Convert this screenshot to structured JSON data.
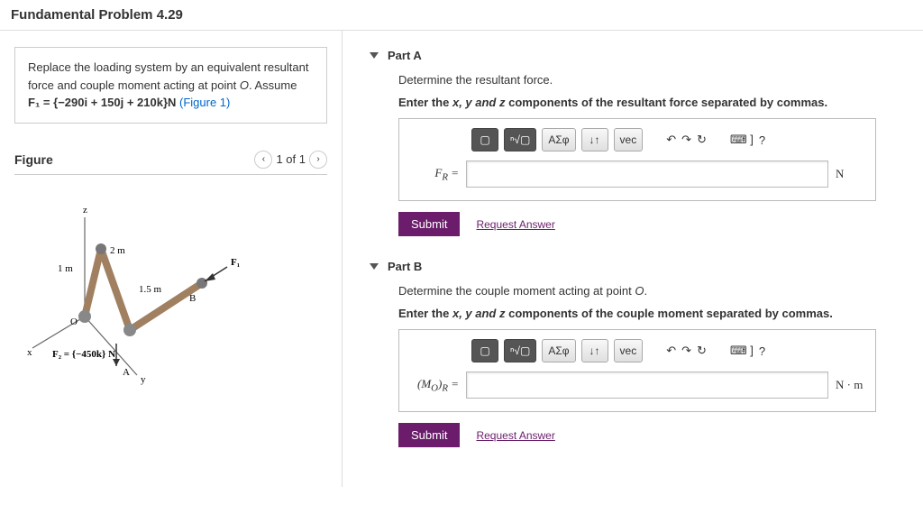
{
  "page_title": "Fundamental Problem 4.29",
  "problem": {
    "line1": "Replace the loading system by an equivalent resultant force and couple moment acting at point ",
    "line1_var": "O",
    "line1_tail": ". Assume",
    "equation": "F₁ = {−290i + 150j + 210k}N",
    "figure_link": "(Figure 1)"
  },
  "figure": {
    "title": "Figure",
    "nav_label": "1 of 1",
    "labels": {
      "z": "z",
      "x": "x",
      "y": "y",
      "O": "O",
      "A": "A",
      "B": "B",
      "one_m": "1 m",
      "two_m": "2 m",
      "one5_m": "1.5 m",
      "F1": "F₁",
      "F2": "F₂ = {−450k} N"
    }
  },
  "partA": {
    "title": "Part A",
    "prompt": "Determine the resultant force.",
    "instruction_prefix": "Enter the ",
    "instruction_vars": "x, y and z",
    "instruction_suffix": " components of the resultant force separated by commas.",
    "var_label": "F_R =",
    "unit": "N",
    "submit": "Submit",
    "request": "Request Answer"
  },
  "partB": {
    "title": "Part B",
    "prompt": "Determine the couple moment acting at point ",
    "prompt_var": "O",
    "prompt_tail": ".",
    "instruction_prefix": "Enter the ",
    "instruction_vars": "x, y and z",
    "instruction_suffix": " components of the couple moment separated by commas.",
    "var_label": "(M_O)_R =",
    "unit": "N · m",
    "submit": "Submit",
    "request": "Request Answer"
  },
  "toolbar": {
    "templates": "▢",
    "root": "ⁿ√▢",
    "greek": "ΑΣφ",
    "updown": "↓↑",
    "vec": "vec",
    "undo": "↶",
    "redo": "↷",
    "reset": "↻",
    "keyboard": "⌨ ]",
    "help": "?"
  }
}
